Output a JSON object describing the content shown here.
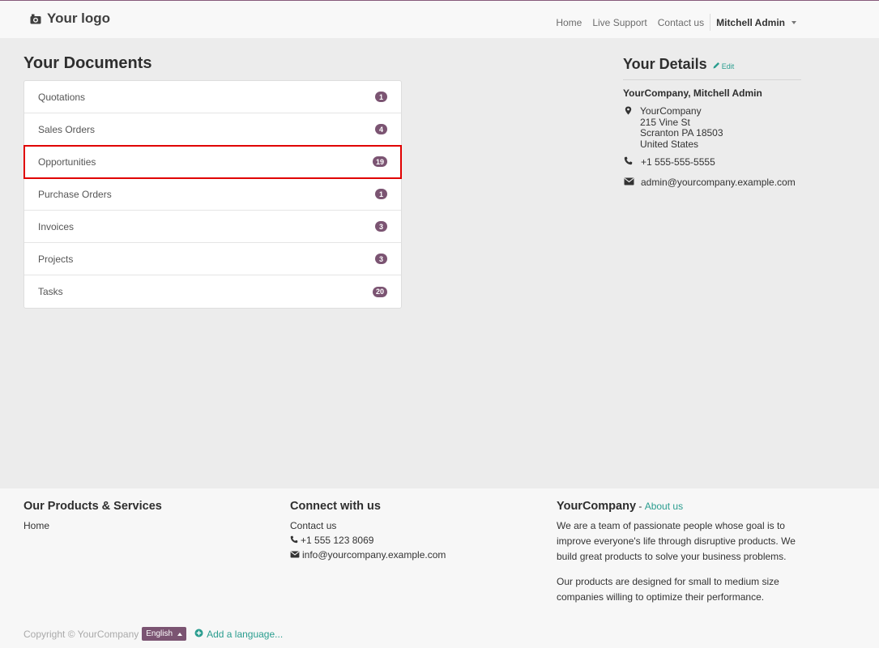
{
  "header": {
    "logo_text": "Your logo",
    "nav": [
      "Home",
      "Live Support",
      "Contact us"
    ],
    "user": "Mitchell Admin"
  },
  "documents": {
    "title": "Your Documents",
    "items": [
      {
        "label": "Quotations",
        "count": "1"
      },
      {
        "label": "Sales Orders",
        "count": "4"
      },
      {
        "label": "Opportunities",
        "count": "19"
      },
      {
        "label": "Purchase Orders",
        "count": "1"
      },
      {
        "label": "Invoices",
        "count": "3"
      },
      {
        "label": "Projects",
        "count": "3"
      },
      {
        "label": "Tasks",
        "count": "20"
      }
    ]
  },
  "details": {
    "title": "Your Details",
    "edit": "Edit",
    "name": "YourCompany, Mitchell Admin",
    "address": [
      "YourCompany",
      "215 Vine St",
      "Scranton PA 18503",
      "United States"
    ],
    "phone": "+1 555-555-5555",
    "email": "admin@yourcompany.example.com"
  },
  "footer": {
    "products_title": "Our Products & Services",
    "products_link": "Home",
    "connect_title": "Connect with us",
    "connect_link": "Contact us",
    "connect_phone": "+1 555 123 8069",
    "connect_email": "info@yourcompany.example.com",
    "company_title": "YourCompany",
    "company_dash": " - ",
    "about_link": "About us",
    "about_text_1": "We are a team of passionate people whose goal is to improve everyone's life through disruptive products. We build great products to solve your business problems.",
    "about_text_2": "Our products are designed for small to medium size companies willing to optimize their performance.",
    "copyright": "Copyright © YourCompany",
    "language": "English",
    "add_language": "Add a language..."
  },
  "colors": {
    "brand": "#7b5472",
    "link": "#2a9d8f",
    "highlight": "#e00000"
  }
}
